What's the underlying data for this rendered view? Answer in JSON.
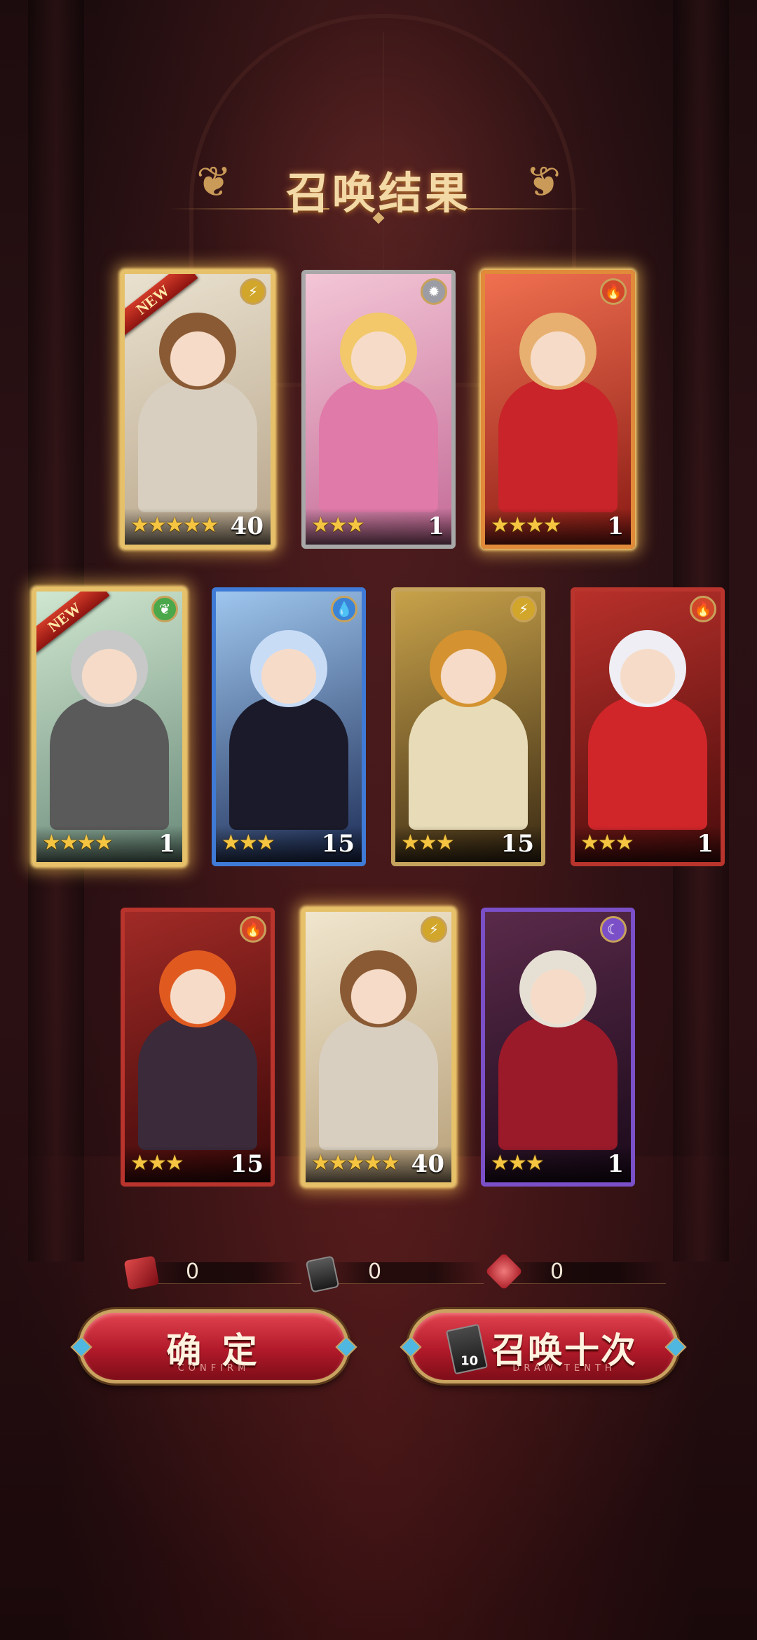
{
  "title": "召唤结果",
  "cards": [
    {
      "stars": "★★★★★",
      "count": "40",
      "new": "NEW",
      "element": "⚡",
      "frame": "gold",
      "glow": true,
      "palette": {
        "bg1": "#e9e1cf",
        "bg2": "#b8a58a",
        "hair": "#8a5a34",
        "body": "#d8cfc0",
        "elem": "#d1a62a"
      }
    },
    {
      "stars": "★★★",
      "count": "1",
      "new": "",
      "element": "✹",
      "frame": "silver",
      "glow": false,
      "palette": {
        "bg1": "#f3c6d6",
        "bg2": "#c46b97",
        "hair": "#f2c86a",
        "body": "#e07aa8",
        "elem": "#9c9ca4"
      }
    },
    {
      "stars": "★★★★",
      "count": "1",
      "new": "",
      "element": "🔥",
      "frame": "orange",
      "glow": true,
      "palette": {
        "bg1": "#f07050",
        "bg2": "#8a1a14",
        "hair": "#e8b070",
        "body": "#c8242a",
        "elem": "#d2462a"
      }
    },
    {
      "stars": "★★★★",
      "count": "1",
      "new": "NEW",
      "element": "❦",
      "frame": "gold",
      "glow": true,
      "palette": {
        "bg1": "#cfe6cf",
        "bg2": "#6a8a7a",
        "hair": "#c8c8c8",
        "body": "#5a5a5a",
        "elem": "#4aa84a"
      }
    },
    {
      "stars": "★★★",
      "count": "15",
      "new": "",
      "element": "💧",
      "frame": "blue",
      "glow": false,
      "palette": {
        "bg1": "#9ec6ee",
        "bg2": "#1e2e58",
        "hair": "#c8dcf6",
        "body": "#1a1a2a",
        "elem": "#3a84d8"
      }
    },
    {
      "stars": "★★★",
      "count": "15",
      "new": "",
      "element": "⚡",
      "frame": "bronze",
      "glow": false,
      "palette": {
        "bg1": "#c8a24a",
        "bg2": "#3a2a14",
        "hair": "#d49230",
        "body": "#e8dcb8",
        "elem": "#d1a62a"
      }
    },
    {
      "stars": "★★★",
      "count": "1",
      "new": "",
      "element": "🔥",
      "frame": "red",
      "glow": false,
      "palette": {
        "bg1": "#b8302a",
        "bg2": "#4a0c0c",
        "hair": "#eeeef4",
        "body": "#d0262a",
        "elem": "#d2462a"
      }
    },
    {
      "stars": "★★★",
      "count": "15",
      "new": "",
      "element": "🔥",
      "frame": "red",
      "glow": false,
      "palette": {
        "bg1": "#a02a26",
        "bg2": "#3a0808",
        "hair": "#e05a20",
        "body": "#3a2a3a",
        "elem": "#d2462a"
      }
    },
    {
      "stars": "★★★★★",
      "count": "40",
      "new": "",
      "element": "⚡",
      "frame": "gold",
      "glow": true,
      "palette": {
        "bg1": "#f0e6ce",
        "bg2": "#b8a07a",
        "hair": "#8a5a34",
        "body": "#d8cfc0",
        "elem": "#d1a62a"
      }
    },
    {
      "stars": "★★★",
      "count": "1",
      "new": "",
      "element": "☾",
      "frame": "purple",
      "glow": false,
      "palette": {
        "bg1": "#5a2a4a",
        "bg2": "#1a0a1a",
        "hair": "#e6e0d4",
        "body": "#9a1a2a",
        "elem": "#7a4fc8"
      }
    }
  ],
  "resources": [
    {
      "icon": "scroll-icon",
      "value": "0",
      "color": "#b8202a"
    },
    {
      "icon": "summon-ticket-icon",
      "value": "0",
      "color": "#4a4a4a"
    },
    {
      "icon": "gem-icon",
      "value": "0",
      "color": "#d0404a"
    }
  ],
  "buttons": {
    "confirm": {
      "label": "确  定",
      "sub": "CONFIRM"
    },
    "draw_ten": {
      "label": "召唤十次",
      "sub": "DRAW TENTH",
      "ticket": "10"
    }
  }
}
